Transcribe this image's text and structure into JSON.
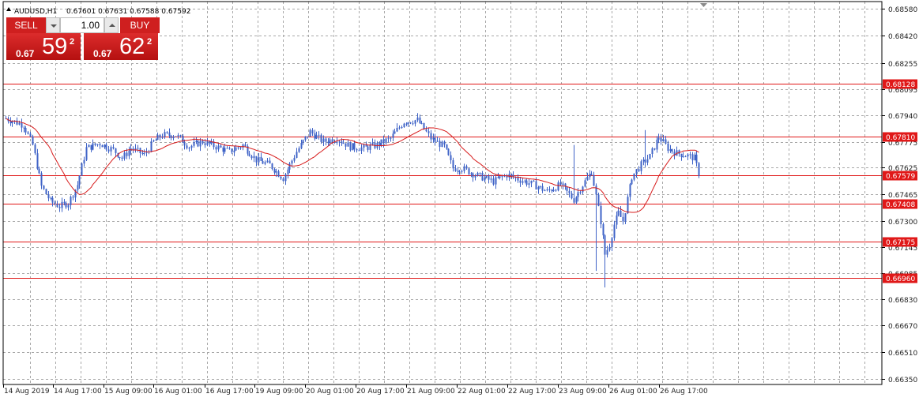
{
  "header": {
    "symbol": "AUDUSD,H1",
    "ohlc": "0.67601 0.67631 0.67588 0.67592"
  },
  "trade_panel": {
    "sell_label": "SELL",
    "buy_label": "BUY",
    "lot_value": "1.00",
    "sell_quote": {
      "prefix": "0.67",
      "big": "59",
      "small": "2"
    },
    "buy_quote": {
      "prefix": "0.67",
      "big": "62",
      "small": "2"
    }
  },
  "colors": {
    "background": "#ffffff",
    "grid": "#a8a8a8",
    "candle": "#3f63c7",
    "ma_line": "#d71c1c",
    "level_line": "#e01818",
    "level_label_bg": "#e01818",
    "axis_text": "#222222"
  },
  "chart_data": {
    "type": "candlestick",
    "x_tick_labels": [
      "14 Aug 2019",
      "14 Aug 17:00",
      "15 Aug 09:00",
      "16 Aug 01:00",
      "16 Aug 17:00",
      "19 Aug 09:00",
      "20 Aug 01:00",
      "20 Aug 17:00",
      "21 Aug 09:00",
      "22 Aug 01:00",
      "22 Aug 17:00",
      "23 Aug 09:00",
      "26 Aug 01:00",
      "26 Aug 17:00"
    ],
    "y_tick_labels": [
      "0.68580",
      "0.68420",
      "0.68255",
      "0.68095",
      "0.67940",
      "0.67775",
      "0.67625",
      "0.67465",
      "0.67300",
      "0.67145",
      "0.66985",
      "0.66830",
      "0.66670",
      "0.66510",
      "0.66350"
    ],
    "y_ticks": [
      0.6858,
      0.6842,
      0.68255,
      0.68095,
      0.6794,
      0.67775,
      0.67625,
      0.67465,
      0.673,
      0.67145,
      0.66985,
      0.6683,
      0.6667,
      0.6651,
      0.6635
    ],
    "ylim": [
      0.66315,
      0.68625
    ],
    "horizontal_levels": [
      "0.68128",
      "0.67810",
      "0.67579",
      "0.67408",
      "0.67175",
      "0.66960"
    ],
    "moving_average": true,
    "grid": true,
    "anchors": [
      [
        0,
        0.6792
      ],
      [
        8,
        0.6788
      ],
      [
        12,
        0.6776
      ],
      [
        16,
        0.6751
      ],
      [
        20,
        0.6742
      ],
      [
        24,
        0.6739
      ],
      [
        28,
        0.6741
      ],
      [
        32,
        0.6752
      ],
      [
        36,
        0.6774
      ],
      [
        42,
        0.6777
      ],
      [
        48,
        0.6773
      ],
      [
        52,
        0.6768
      ],
      [
        56,
        0.6774
      ],
      [
        62,
        0.677
      ],
      [
        66,
        0.6778
      ],
      [
        70,
        0.6782
      ],
      [
        76,
        0.6782
      ],
      [
        82,
        0.6775
      ],
      [
        88,
        0.6778
      ],
      [
        94,
        0.6775
      ],
      [
        100,
        0.6772
      ],
      [
        106,
        0.6776
      ],
      [
        112,
        0.6767
      ],
      [
        118,
        0.6764
      ],
      [
        124,
        0.6756
      ],
      [
        130,
        0.6772
      ],
      [
        136,
        0.6784
      ],
      [
        142,
        0.6778
      ],
      [
        148,
        0.678
      ],
      [
        154,
        0.6775
      ],
      [
        160,
        0.6774
      ],
      [
        166,
        0.6776
      ],
      [
        172,
        0.678
      ],
      [
        178,
        0.679
      ],
      [
        184,
        0.6791
      ],
      [
        190,
        0.678
      ],
      [
        196,
        0.6775
      ],
      [
        200,
        0.6762
      ],
      [
        204,
        0.6762
      ],
      [
        210,
        0.6758
      ],
      [
        218,
        0.6754
      ],
      [
        224,
        0.6758
      ],
      [
        230,
        0.6755
      ],
      [
        236,
        0.6752
      ],
      [
        242,
        0.6748
      ],
      [
        248,
        0.6752
      ],
      [
        254,
        0.6743
      ],
      [
        258,
        0.6752
      ],
      [
        262,
        0.676
      ],
      [
        266,
        0.673
      ],
      [
        268,
        0.671
      ],
      [
        270,
        0.6716
      ],
      [
        272,
        0.6728
      ],
      [
        274,
        0.6735
      ],
      [
        276,
        0.673
      ],
      [
        280,
        0.6757
      ],
      [
        284,
        0.6764
      ],
      [
        288,
        0.6769
      ],
      [
        292,
        0.6781
      ],
      [
        296,
        0.6774
      ],
      [
        300,
        0.6771
      ],
      [
        304,
        0.677
      ],
      [
        308,
        0.6768
      ],
      [
        310,
        0.6759
      ]
    ],
    "spikes": [
      [
        264,
        0.67
      ],
      [
        268,
        0.669
      ],
      [
        254,
        0.6776
      ],
      [
        286,
        0.6785
      ]
    ]
  }
}
